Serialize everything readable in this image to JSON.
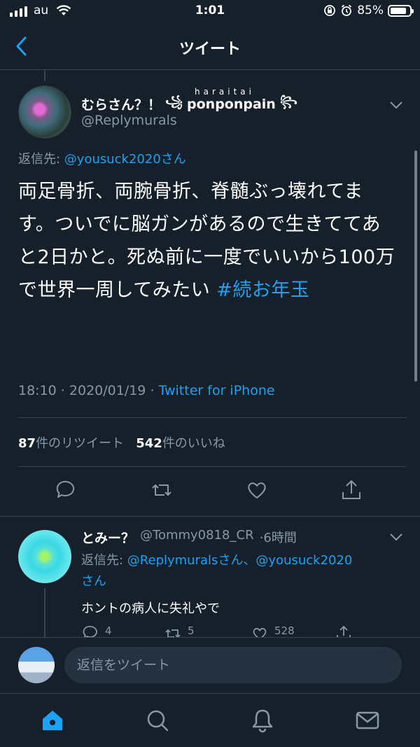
{
  "status_bar": {
    "carrier": "au",
    "time": "1:01",
    "battery_text": "85%",
    "battery_level": 0.85
  },
  "header": {
    "title": "ツイート"
  },
  "tweet": {
    "display_name": "むらさん？！",
    "name_deco": "ponponpain",
    "name_small": "haraitai",
    "handle": "@Replymurals",
    "reply_prefix": "返信先: ",
    "reply_user": "@yousuck2020さん",
    "text": "両足骨折、両腕骨折、脊髄ぶっ壊れてます。ついでに脳ガンがあるので生きててあと2日かと。死ぬ前に一度でいいから100万で世界一周してみたい ",
    "hashtag": "#続お年玉",
    "time": "18:10",
    "date": "2020/01/19",
    "source": "Twitter for iPhone",
    "retweet_count": "87",
    "retweet_label": "件のリツイート",
    "like_count": "542",
    "like_label": "件のいいね"
  },
  "reply": {
    "display_name": "とみー？",
    "handle": "@Tommy0818_CR",
    "age": "6時間",
    "reply_prefix": "返信先: ",
    "reply_users": "@Replymuralsさん、@yousuck2020",
    "reply_suffix": "さん",
    "text": "ホントの病人に失礼やで",
    "reply_count": "4",
    "retweet_count": "5",
    "like_count": "528"
  },
  "composer": {
    "placeholder": "返信をツイート"
  },
  "icons": {
    "back": "chevron-left-icon",
    "caret": "chevron-down-icon",
    "reply": "comment-icon",
    "retweet": "retweet-icon",
    "like": "heart-icon",
    "share": "share-icon",
    "home": "home-icon",
    "search": "search-icon",
    "notifications": "bell-icon",
    "messages": "mail-icon"
  },
  "colors": {
    "background": "#15202b",
    "accent": "#1da1f2",
    "muted": "#8899a6",
    "divider": "#38444d"
  }
}
